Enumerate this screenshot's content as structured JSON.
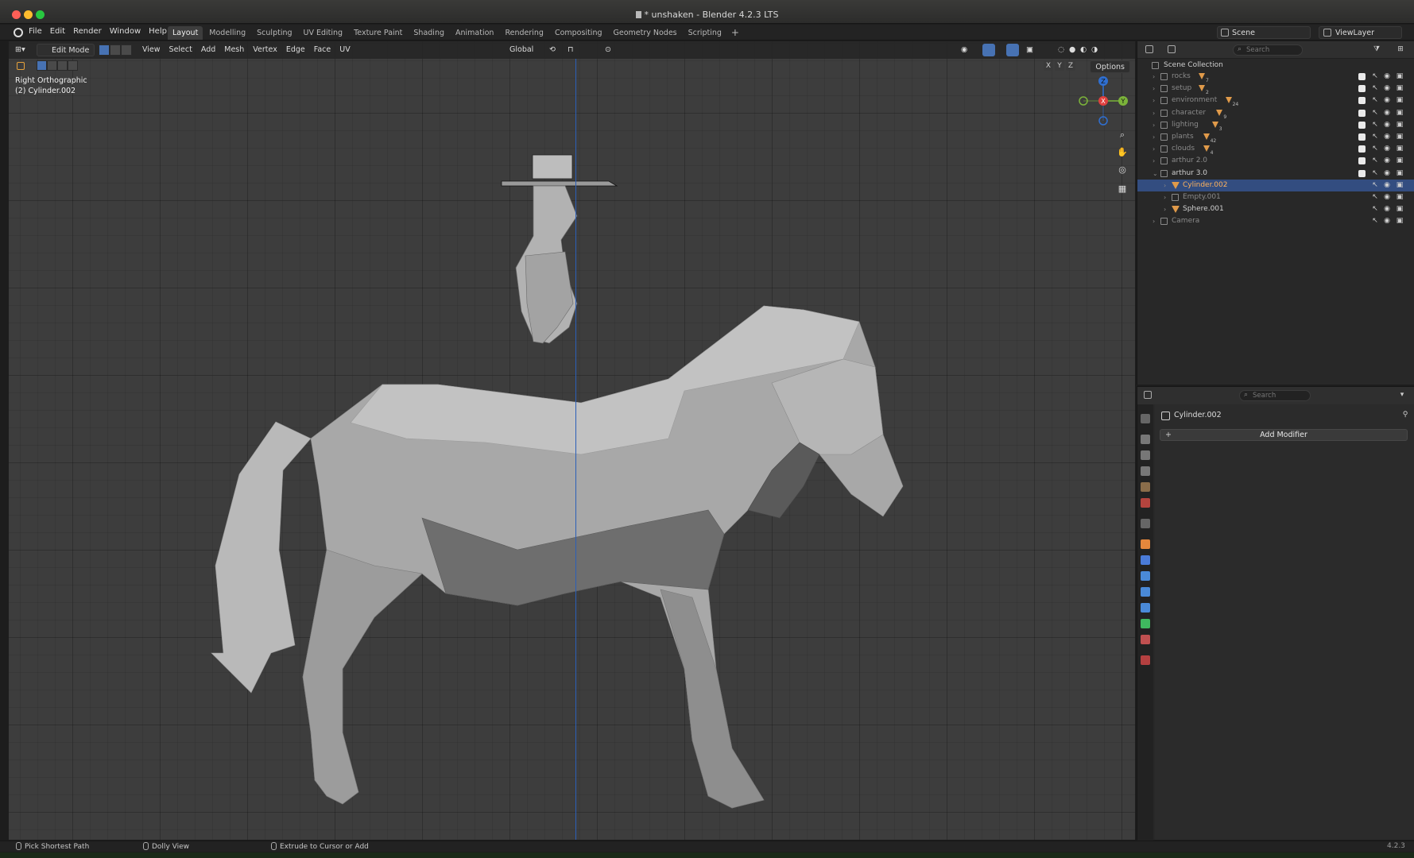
{
  "window": {
    "title": "* unshaken - Blender 4.2.3 LTS"
  },
  "menus": [
    "File",
    "Edit",
    "Render",
    "Window",
    "Help"
  ],
  "workspace_tabs": [
    {
      "label": "Layout",
      "active": true
    },
    {
      "label": "Modelling"
    },
    {
      "label": "Sculpting"
    },
    {
      "label": "UV Editing"
    },
    {
      "label": "Texture Paint"
    },
    {
      "label": "Shading"
    },
    {
      "label": "Animation"
    },
    {
      "label": "Rendering"
    },
    {
      "label": "Compositing"
    },
    {
      "label": "Geometry Nodes"
    },
    {
      "label": "Scripting"
    }
  ],
  "scene": {
    "name": "Scene",
    "view_layer": "ViewLayer"
  },
  "viewport": {
    "mode": "Edit Mode",
    "menus": [
      "View",
      "Select",
      "Add",
      "Mesh",
      "Vertex",
      "Edge",
      "Face",
      "UV"
    ],
    "transform_orientation": "Global",
    "options_label": "Options",
    "axis_labels": [
      "X",
      "Y",
      "Z"
    ],
    "view_name": "Right Orthographic",
    "active_object": "(2) Cylinder.002",
    "gizmo": {
      "x": "X",
      "y": "Y",
      "z": "Z"
    }
  },
  "outliner": {
    "search_placeholder": "Search",
    "root": "Scene Collection",
    "rows": [
      {
        "label": "rocks",
        "badge": "7",
        "dim": true
      },
      {
        "label": "setup",
        "badge": "2",
        "dim": true
      },
      {
        "label": "environment",
        "badge": "24",
        "dim": true
      },
      {
        "label": "character",
        "badge": "9",
        "dim": true
      },
      {
        "label": "lighting",
        "badge": "3",
        "dim": true
      },
      {
        "label": "plants",
        "badge": "42",
        "dim": true
      },
      {
        "label": "clouds",
        "badge": "4",
        "dim": true
      },
      {
        "label": "arthur 2.0",
        "dim": true
      },
      {
        "label": "arthur 3.0"
      },
      {
        "label": "Cylinder.002",
        "selected": true
      },
      {
        "label": "Empty.001",
        "dim": true
      },
      {
        "label": "Sphere.001"
      },
      {
        "label": "Camera",
        "dim": true
      }
    ]
  },
  "properties": {
    "search_placeholder": "Search",
    "object_name": "Cylinder.002",
    "add_modifier": "Add Modifier"
  },
  "statusbar": {
    "left": "Pick Shortest Path",
    "middle": "Dolly View",
    "right": "Extrude to Cursor or Add",
    "version": "4.2.3"
  }
}
